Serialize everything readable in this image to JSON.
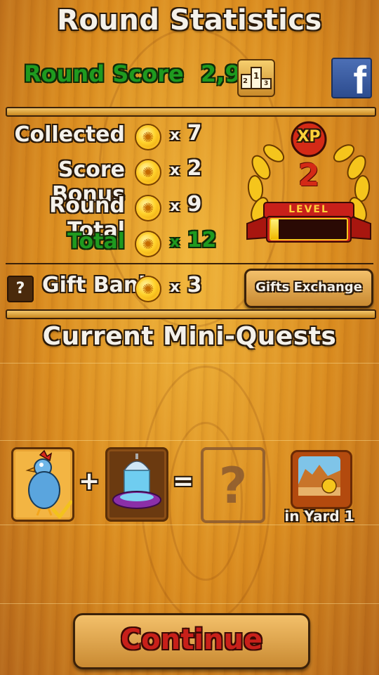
{
  "header": {
    "title": "Round Statistics",
    "score_label": "Round Score",
    "score_value": "2,980",
    "leaderboard_icon": "podium-icon",
    "leaderboard_digits": [
      "2",
      "1",
      "3"
    ],
    "facebook_icon": "facebook-icon",
    "facebook_letter": "f"
  },
  "stats": {
    "rows": [
      {
        "label": "Collected",
        "x": "x",
        "value": "7"
      },
      {
        "label": "Score Bonus",
        "x": "x",
        "value": "2"
      },
      {
        "label": "Round Total",
        "x": "x",
        "value": "9"
      },
      {
        "label": "Total",
        "x": "x",
        "value": "12"
      }
    ],
    "coin_icon": "sun-coin-icon"
  },
  "xp": {
    "badge": "XP",
    "level_number": "2",
    "level_label": "LEVEL",
    "progress": 0.1
  },
  "gift_bank": {
    "help_label": "?",
    "label": "Gift Bank",
    "x": "x",
    "value": "3",
    "exchange_button": "Gifts Exchange"
  },
  "quests": {
    "title": "Current Mini-Quests",
    "plus": "+",
    "equals": "=",
    "unknown": "?",
    "location": "in Yard 1",
    "check_icon": "checkmark-icon",
    "chicken_icon": "blue-chicken-icon",
    "feeder_icon": "water-feeder-icon",
    "yard_icon": "desert-yard-icon"
  },
  "footer": {
    "continue_label": "Continue"
  },
  "colors": {
    "accent_green": "#1f9a1f",
    "continue_red": "#c8201a",
    "facebook_blue": "#3b5998",
    "xp_red": "#c8201a"
  }
}
